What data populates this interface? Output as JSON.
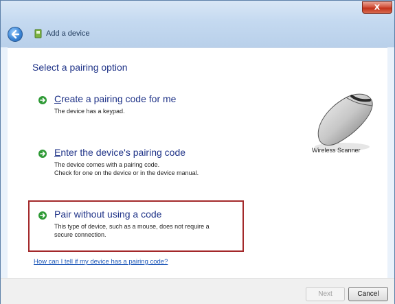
{
  "window": {
    "title": "Add a device",
    "close_glyph": "x"
  },
  "content": {
    "heading": "Select a pairing option",
    "options": [
      {
        "title": "Create a pairing code for me",
        "desc": [
          "The device has a keypad."
        ]
      },
      {
        "title": "Enter the device's pairing code",
        "desc": [
          "The device comes with a pairing code.",
          "Check for one on the device or in the device manual."
        ]
      },
      {
        "title": "Pair without using a code",
        "desc": [
          "This type of device, such as a mouse, does not require a",
          "secure connection."
        ]
      }
    ],
    "help_link": "How can I tell if my device has a pairing code?",
    "device_label": "Wireless Scanner"
  },
  "footer": {
    "next_label": "Next",
    "cancel_label": "Cancel"
  },
  "colors": {
    "accent": "#1e3287",
    "highlight": "#a3282a",
    "arrow": "#2f9a36"
  },
  "icons": [
    "back-arrow-icon",
    "device-icon",
    "green-arrow-icon",
    "mouse-icon"
  ]
}
